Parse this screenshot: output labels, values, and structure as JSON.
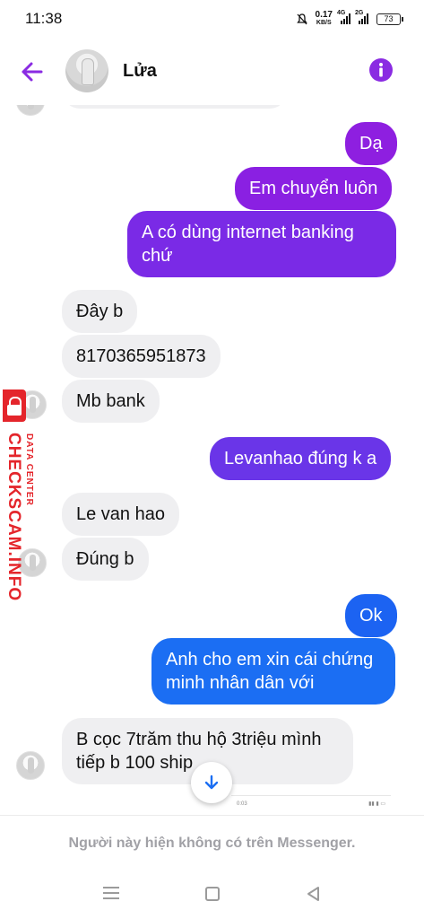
{
  "status_bar": {
    "time": "11:38",
    "speed_value": "0.17",
    "speed_unit": "KB/S",
    "signal1_label": "4G",
    "signal2_label": "2G",
    "battery": "73"
  },
  "header": {
    "contact_name": "Lửa"
  },
  "messages": [
    {
      "dir": "out",
      "text": "Dạ"
    },
    {
      "dir": "out",
      "text": "Em chuyển luôn"
    },
    {
      "dir": "out",
      "text": "A có dùng internet banking chứ",
      "lines": [
        "A có dùng internet banking",
        "chứ"
      ]
    },
    {
      "dir": "in",
      "text": "Đây b"
    },
    {
      "dir": "in",
      "text": "8170365951873"
    },
    {
      "dir": "in",
      "text": "Mb bank"
    },
    {
      "dir": "out",
      "text": "Levanhao đúng k a"
    },
    {
      "dir": "in",
      "text": "Le van hao"
    },
    {
      "dir": "in",
      "text": "Đúng b"
    },
    {
      "dir": "out",
      "text": "Ok"
    },
    {
      "dir": "out",
      "text": "Anh cho em xin cái chứng minh nhân dân với",
      "lines": [
        "Anh cho em xin cái chứng",
        "minh nhân dân với"
      ]
    },
    {
      "dir": "in",
      "text": "B cọc 7trăm thu hộ 3triệu mình tiếp b 100 ship",
      "lines": [
        "B cọc 7trăm thu hộ 3triệu mình",
        "tiếp b 100 ship"
      ]
    }
  ],
  "watermark": {
    "main": "CHECKSCAM.INFO",
    "sub": "DATA CENTER"
  },
  "embedded_bar": {
    "time": "0:03"
  },
  "footer": {
    "unavailable_text": "Người này hiện không có trên Messenger."
  },
  "colors": {
    "accent": "#8a2be2",
    "bubble_purple": "#8e1fe0",
    "bubble_violet": "#6a35e8",
    "bubble_blue": "#1b6ef3",
    "incoming_bg": "#efeff1",
    "watermark_red": "#e4252b"
  },
  "icons": {
    "back": "back-arrow-icon",
    "info": "info-icon",
    "scroll_down": "arrow-down-icon"
  }
}
